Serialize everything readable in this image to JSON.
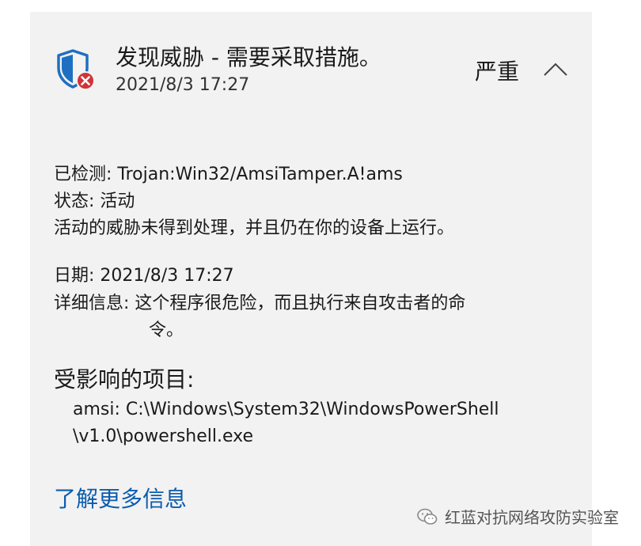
{
  "alert": {
    "title": "发现威胁 - 需要采取措施。",
    "timestamp": "2021/8/3 17:27",
    "severity": "严重"
  },
  "details": {
    "detected": "已检测:  Trojan:Win32/AmsiTamper.A!ams",
    "status": "状态: 活动",
    "status_desc": "活动的威胁未得到处理，并且仍在你的设备上运行。",
    "date": "日期:  2021/8/3 17:27",
    "info_line1": "详细信息: 这个程序很危险，而且执行来自攻击者的命",
    "info_line2": "令。"
  },
  "affected": {
    "heading": "受影响的项目:",
    "path_line1": "amsi: C:\\Windows\\System32\\WindowsPowerShell",
    "path_line2": "\\v1.0\\powershell.exe"
  },
  "links": {
    "learn_more": "了解更多信息"
  },
  "watermark": "红蓝对抗网络攻防实验室",
  "colors": {
    "shield": "#1e6fc2",
    "badge": "#d13438",
    "link": "#0b5cad",
    "card_bg": "#f2f2f2"
  }
}
